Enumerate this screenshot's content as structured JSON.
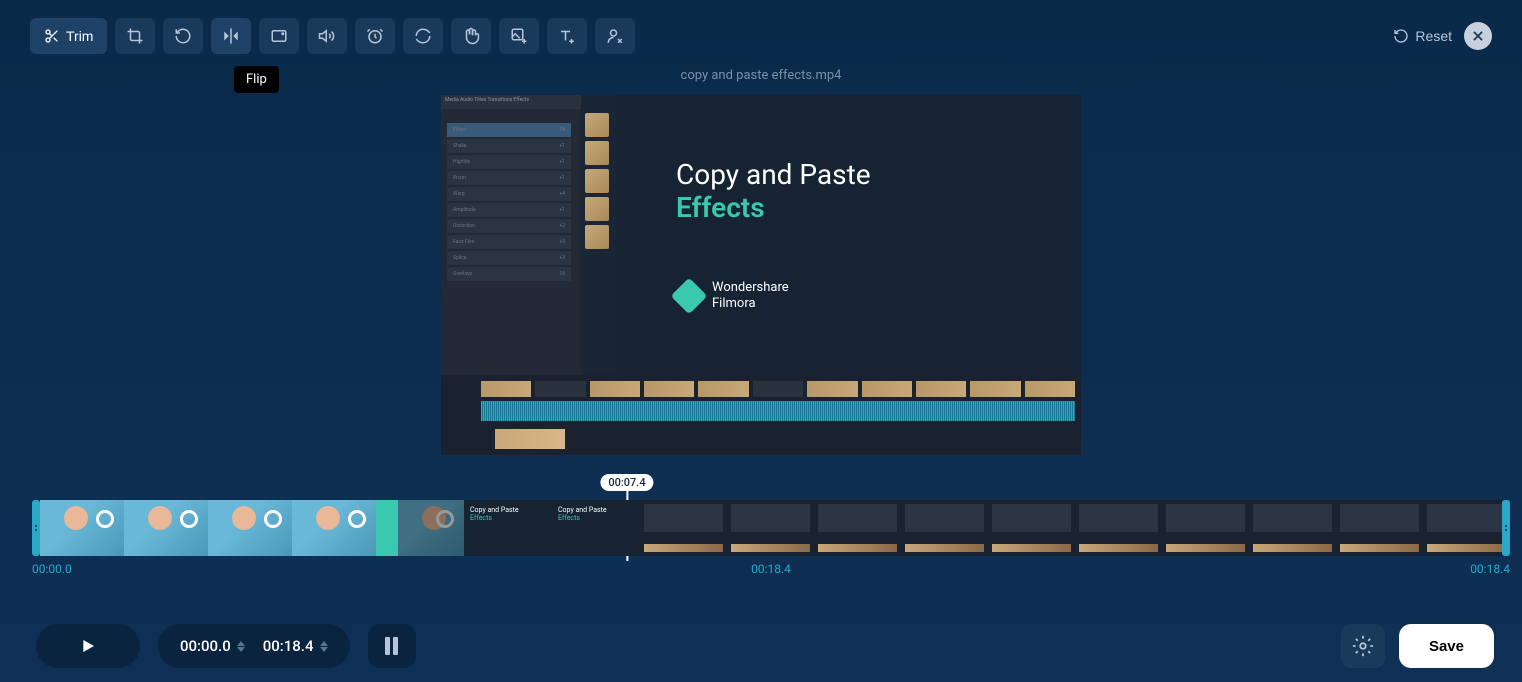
{
  "toolbar": {
    "trim_label": "Trim",
    "tooltip": "Flip",
    "reset_label": "Reset"
  },
  "filename": "copy and paste effects.mp4",
  "preview": {
    "title_line1": "Copy and Paste",
    "title_line2": "Effects",
    "brand_line1": "Wondershare",
    "brand_line2": "Filmora"
  },
  "scrubber": {
    "playhead_time": "00:07.4",
    "start_time": "00:00.0",
    "mid_time": "00:18.4",
    "end_time": "00:18.4",
    "frame_title_line1": "Copy and Paste",
    "frame_title_line2": "Effects"
  },
  "controls": {
    "current_time": "00:00.0",
    "total_time": "00:18.4",
    "save_label": "Save"
  }
}
